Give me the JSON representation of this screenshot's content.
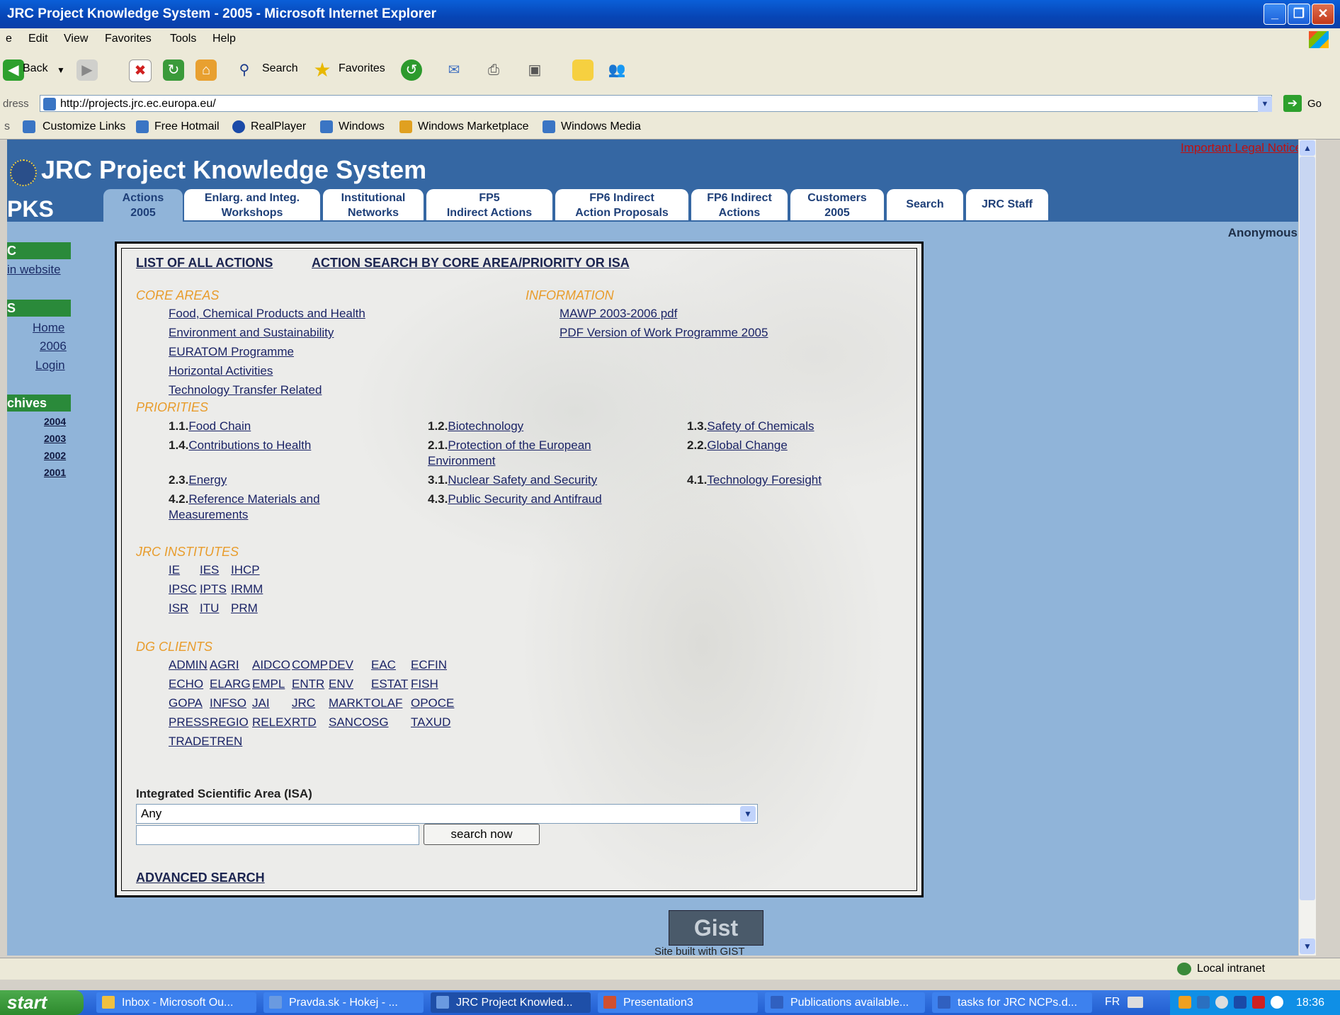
{
  "window": {
    "title": "JRC Project Knowledge System - 2005 - Microsoft Internet Explorer"
  },
  "menu": [
    "e",
    "Edit",
    "View",
    "Favorites",
    "Tools",
    "Help"
  ],
  "toolbar": {
    "back": "Back",
    "search": "Search",
    "favorites": "Favorites"
  },
  "address": {
    "label": "dress",
    "url": "http://projects.jrc.ec.europa.eu/",
    "go": "Go"
  },
  "links_bar": {
    "label": "s",
    "items": [
      "Customize Links",
      "Free Hotmail",
      "RealPlayer",
      "Windows",
      "Windows Marketplace",
      "Windows Media"
    ]
  },
  "page": {
    "legal_notice": "Important Legal Notice",
    "site_title": "JRC Project Knowledge System",
    "abbr": "PKS",
    "user": "Anonymous",
    "tabs": [
      {
        "line1": "Actions",
        "line2": "2005"
      },
      {
        "line1": "Enlarg. and Integ.",
        "line2": "Workshops"
      },
      {
        "line1": "Institutional",
        "line2": "Networks"
      },
      {
        "line1": "FP5",
        "line2": "Indirect Actions"
      },
      {
        "line1": "FP6 Indirect",
        "line2": "Action Proposals"
      },
      {
        "line1": "FP6 Indirect",
        "line2": "Actions"
      },
      {
        "line1": "Customers",
        "line2": "2005"
      },
      {
        "line1": "Search",
        "line2": ""
      },
      {
        "line1": "JRC Staff",
        "line2": ""
      }
    ],
    "sidebar": {
      "header1": "C",
      "link_main": "in website",
      "header2": "S",
      "links": [
        "Home",
        "2006",
        "Login"
      ],
      "archives_header": "chives",
      "archives": [
        "2004",
        "2003",
        "2002",
        "2001"
      ]
    },
    "content": {
      "list_all": "LIST OF ALL ACTIONS",
      "action_search": "ACTION SEARCH BY CORE AREA/PRIORITY OR ISA",
      "core_areas_title": "CORE AREAS",
      "core_areas": [
        "Food, Chemical Products and Health",
        "Environment and Sustainability",
        "EURATOM Programme",
        "Horizontal Activities",
        "Technology Transfer Related"
      ],
      "information_title": "INFORMATION",
      "information": [
        "MAWP 2003-2006 pdf",
        "PDF Version of Work Programme 2005"
      ],
      "priorities_title": "PRIORITIES",
      "priorities": [
        {
          "num": "1.1.",
          "label": "Food Chain"
        },
        {
          "num": "1.2.",
          "label": "Biotechnology"
        },
        {
          "num": "1.3.",
          "label": "Safety of Chemicals"
        },
        {
          "num": "1.4.",
          "label": "Contributions to Health"
        },
        {
          "num": "2.1.",
          "label": "Protection of the European Environment"
        },
        {
          "num": "2.2.",
          "label": "Global Change"
        },
        {
          "num": "2.3.",
          "label": "Energy"
        },
        {
          "num": "3.1.",
          "label": "Nuclear Safety and Security"
        },
        {
          "num": "4.1.",
          "label": "Technology Foresight"
        },
        {
          "num": "4.2.",
          "label": "Reference Materials and Measurements"
        },
        {
          "num": "4.3.",
          "label": "Public Security and Antifraud"
        }
      ],
      "institutes_title": "JRC INSTITUTES",
      "institutes": [
        "IE",
        "IES",
        "IHCP",
        "IPSC",
        "IPTS",
        "IRMM",
        "ISR",
        "ITU",
        "PRM"
      ],
      "dg_title": "DG CLIENTS",
      "dg_clients": [
        "ADMIN",
        "AGRI",
        "AIDCO",
        "COMP",
        "DEV",
        "EAC",
        "ECFIN",
        "ECHO",
        "ELARG",
        "EMPL",
        "ENTR",
        "ENV",
        "ESTAT",
        "FISH",
        "GOPA",
        "INFSO",
        "JAI",
        "JRC",
        "MARKT",
        "OLAF",
        "OPOCE",
        "PRESS",
        "REGIO",
        "RELEX",
        "RTD",
        "SANCO",
        "SG",
        "TAXUD",
        "TRADE",
        "TREN"
      ],
      "isa_label": "Integrated Scientific Area (ISA)",
      "isa_selected": "Any",
      "search_input_value": "",
      "search_button": "search now",
      "advanced_search": "ADVANCED SEARCH"
    },
    "footer_logo": "Gist",
    "footer_text": "Site built with GIST"
  },
  "status": {
    "zone": "Local intranet"
  },
  "taskbar": {
    "start": "start",
    "items": [
      "Inbox - Microsoft Ou...",
      "Pravda.sk - Hokej - ...",
      "JRC Project Knowled...",
      "Presentation3",
      "Publications available...",
      "tasks for JRC NCPs.d..."
    ],
    "lang": "FR",
    "clock": "18:36"
  }
}
